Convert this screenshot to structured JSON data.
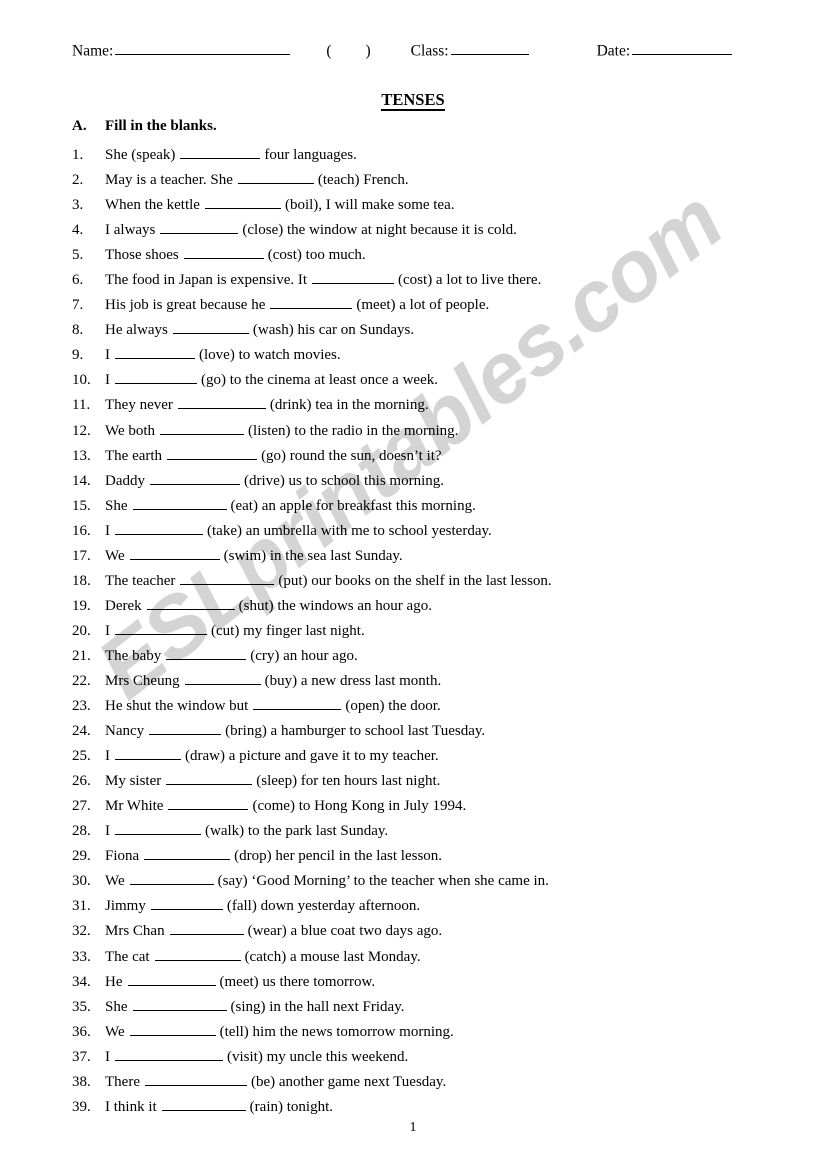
{
  "header": {
    "name_label": "Name:",
    "paren_open": "(",
    "paren_close": ")",
    "class_label": "Class:",
    "date_label": "Date:"
  },
  "title": "TENSES",
  "section": {
    "letter": "A.",
    "instruction": "Fill in the blanks."
  },
  "footer": {
    "page_number": "1"
  },
  "watermark": {
    "text": "ESLprintables.com",
    "color": "#d4d4d4"
  },
  "questions": [
    {
      "num": "1.",
      "before": "She (speak)",
      "blank": 80,
      "after": "four languages."
    },
    {
      "num": "2.",
      "before": "May is a teacher. She",
      "blank": 76,
      "after": "(teach) French."
    },
    {
      "num": "3.",
      "before": "When the kettle",
      "blank": 76,
      "after": "(boil), I will make some tea."
    },
    {
      "num": "4.",
      "before": "I always",
      "blank": 78,
      "after": "(close) the window at night because it is cold."
    },
    {
      "num": "5.",
      "before": "Those shoes",
      "blank": 80,
      "after": "(cost) too much."
    },
    {
      "num": "6.",
      "before": "The food in Japan is expensive. It",
      "blank": 82,
      "after": "(cost) a lot to live there."
    },
    {
      "num": "7.",
      "before": "His job is great because he",
      "blank": 82,
      "after": "(meet) a lot of people."
    },
    {
      "num": "8.",
      "before": "He always",
      "blank": 76,
      "after": "(wash) his car on Sundays."
    },
    {
      "num": "9.",
      "before": "I",
      "blank": 80,
      "after": "(love) to watch movies."
    },
    {
      "num": "10.",
      "before": "I",
      "blank": 82,
      "after": "(go) to the cinema at least once a week."
    },
    {
      "num": "11.",
      "before": "They never",
      "blank": 88,
      "after": "(drink) tea in the morning."
    },
    {
      "num": "12.",
      "before": "We both",
      "blank": 84,
      "after": "(listen) to the radio in the morning."
    },
    {
      "num": "13.",
      "before": "The earth",
      "blank": 90,
      "after": "(go) round the sun, doesn’t it?"
    },
    {
      "num": "14.",
      "before": "Daddy",
      "blank": 90,
      "after": "(drive) us to school this morning."
    },
    {
      "num": "15.",
      "before": "She",
      "blank": 94,
      "after": "(eat) an apple for breakfast this morning."
    },
    {
      "num": "16.",
      "before": "I",
      "blank": 88,
      "after": "(take) an umbrella with me to school yesterday."
    },
    {
      "num": "17.",
      "before": "We",
      "blank": 90,
      "after": "(swim) in the sea last Sunday."
    },
    {
      "num": "18.",
      "before": "The teacher",
      "blank": 94,
      "after": "(put) our books on the shelf in the last lesson."
    },
    {
      "num": "19.",
      "before": "Derek",
      "blank": 88,
      "after": "(shut) the windows an hour ago."
    },
    {
      "num": "20.",
      "before": "I",
      "blank": 92,
      "after": "(cut) my finger last night."
    },
    {
      "num": "21.",
      "before": "The baby",
      "blank": 80,
      "after": "(cry) an hour ago."
    },
    {
      "num": "22.",
      "before": "Mrs Cheung",
      "blank": 76,
      "after": "(buy) a new dress last month."
    },
    {
      "num": "23.",
      "before": "He shut the window but",
      "blank": 88,
      "after": "(open) the door."
    },
    {
      "num": "24.",
      "before": "Nancy",
      "blank": 72,
      "after": "(bring) a hamburger to school last Tuesday."
    },
    {
      "num": "25.",
      "before": "I",
      "blank": 66,
      "after": "(draw) a picture and gave it to my teacher."
    },
    {
      "num": "26.",
      "before": "My sister",
      "blank": 86,
      "after": "(sleep) for ten hours last night."
    },
    {
      "num": "27.",
      "before": "Mr White",
      "blank": 80,
      "after": "(come) to Hong Kong in July 1994."
    },
    {
      "num": "28.",
      "before": "I",
      "blank": 86,
      "after": "(walk) to the park last Sunday."
    },
    {
      "num": "29.",
      "before": "Fiona",
      "blank": 86,
      "after": "(drop) her pencil in the last lesson."
    },
    {
      "num": "30.",
      "before": "We",
      "blank": 84,
      "after": "(say) ‘Good Morning’ to the teacher when she came in."
    },
    {
      "num": "31.",
      "before": "Jimmy",
      "blank": 72,
      "after": "(fall) down yesterday afternoon."
    },
    {
      "num": "32.",
      "before": "Mrs Chan",
      "blank": 74,
      "after": "(wear) a blue coat two days ago."
    },
    {
      "num": "33.",
      "before": "The cat",
      "blank": 86,
      "after": "(catch) a mouse last Monday."
    },
    {
      "num": "34.",
      "before": "He",
      "blank": 88,
      "after": "(meet) us there tomorrow."
    },
    {
      "num": "35.",
      "before": "She",
      "blank": 94,
      "after": "(sing) in the hall next Friday."
    },
    {
      "num": "36.",
      "before": "We",
      "blank": 86,
      "after": "(tell) him the news tomorrow morning."
    },
    {
      "num": "37.",
      "before": "I",
      "blank": 108,
      "after": "(visit) my uncle this weekend."
    },
    {
      "num": "38.",
      "before": "There",
      "blank": 102,
      "after": "(be) another game next Tuesday."
    },
    {
      "num": "39.",
      "before": "I think it",
      "blank": 84,
      "after": "(rain) tonight."
    }
  ]
}
